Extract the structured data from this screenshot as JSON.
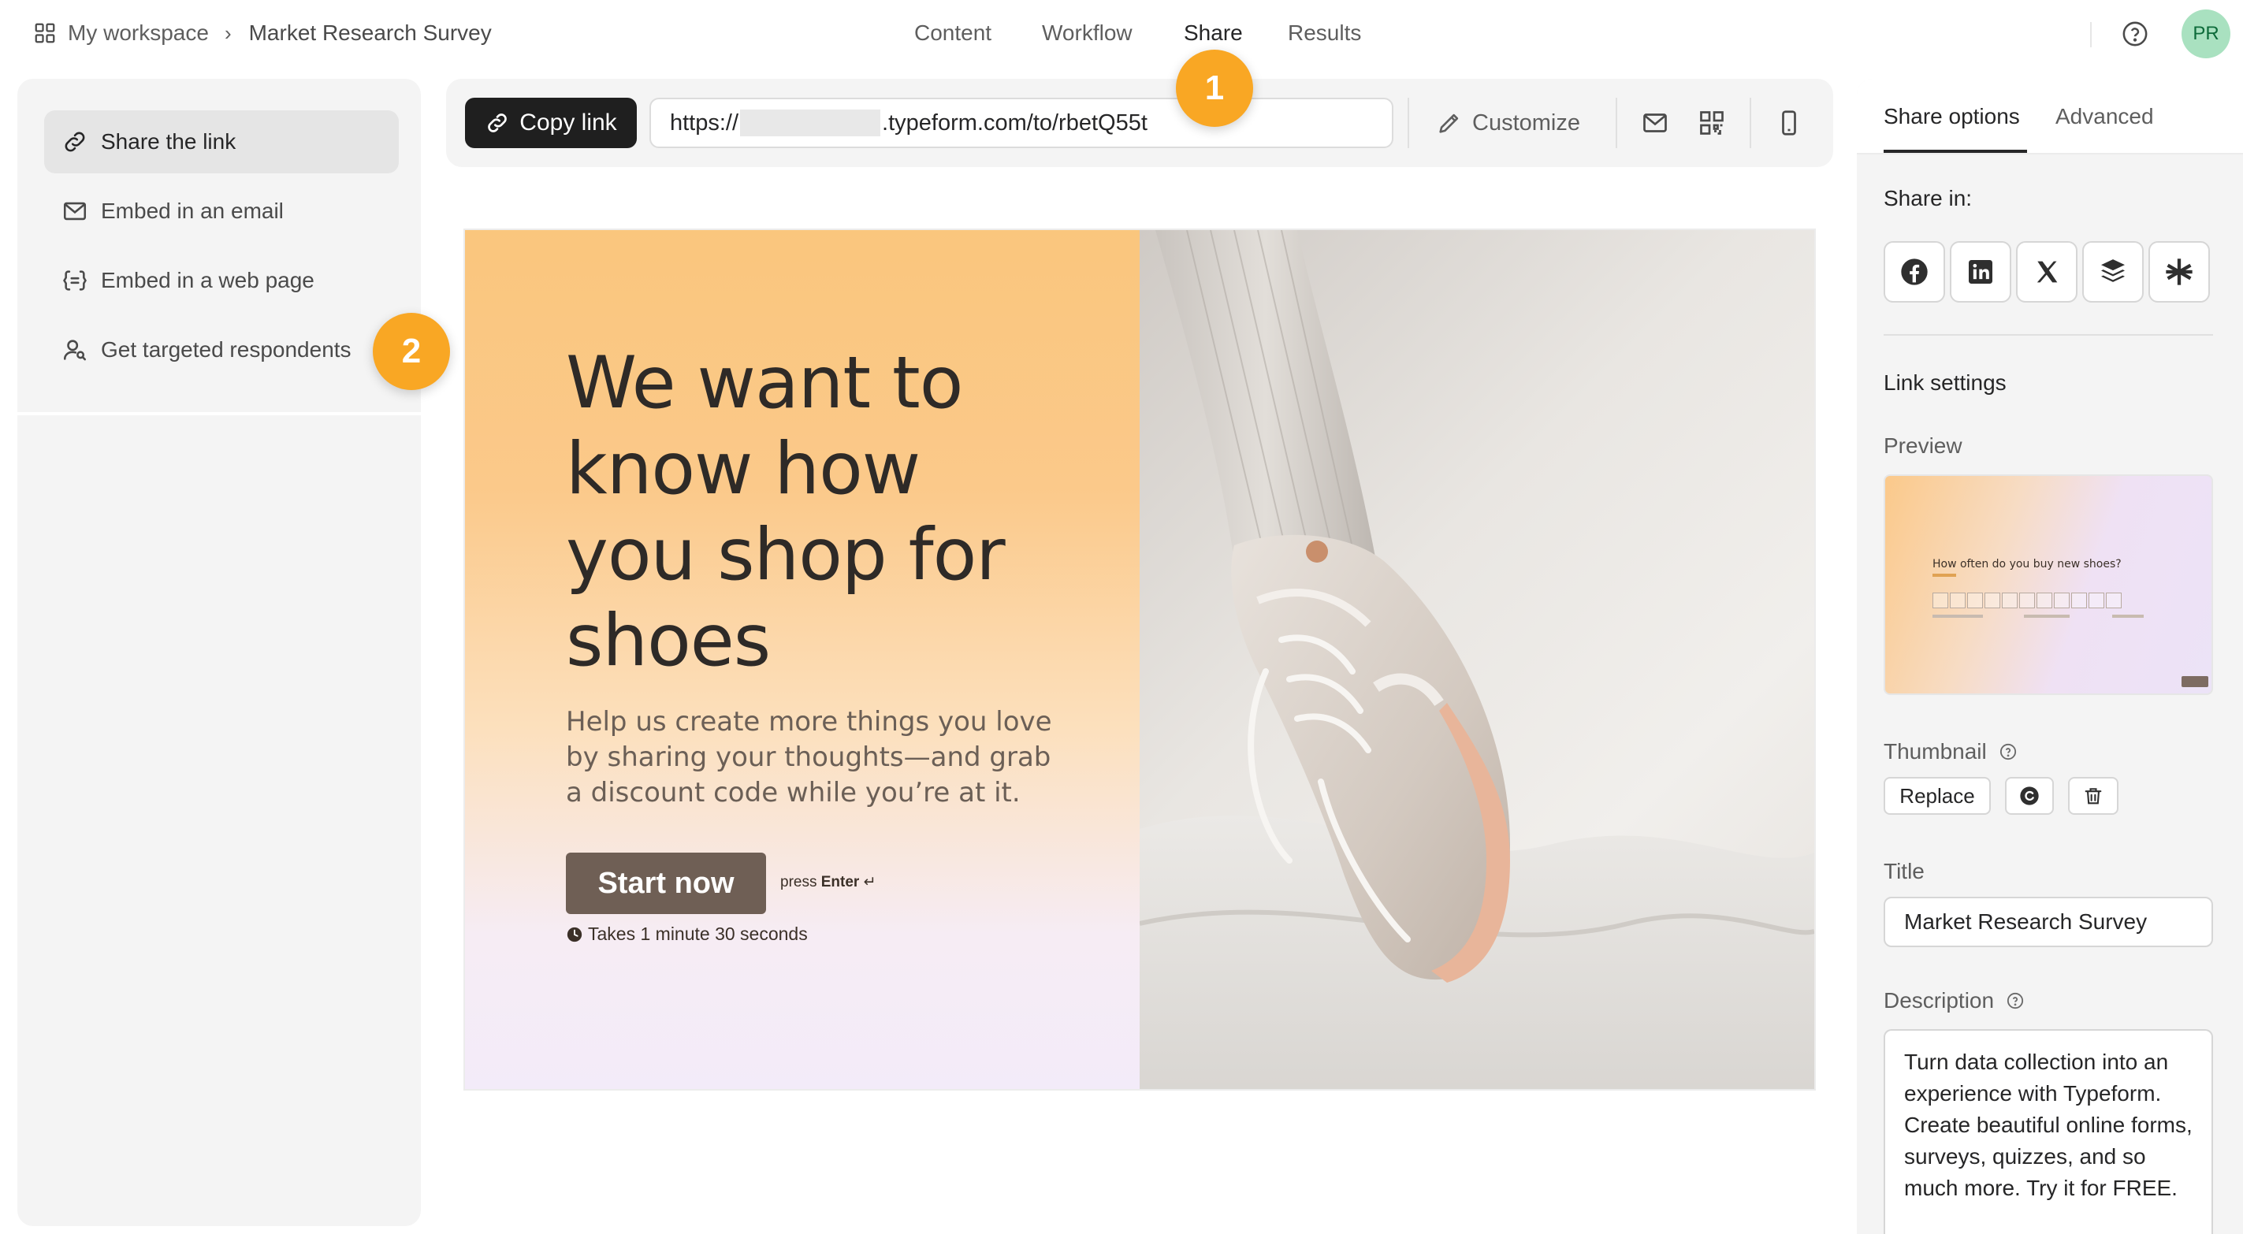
{
  "breadcrumb": {
    "workspace": "My workspace",
    "separator": "›",
    "form": "Market Research Survey"
  },
  "nav": {
    "tabs": [
      "Content",
      "Workflow",
      "Share",
      "Results"
    ],
    "active": "Share"
  },
  "user": {
    "initials": "PR",
    "avatar_color": "#a9e1c0"
  },
  "sidebar": {
    "items": [
      {
        "label": "Share the link",
        "icon": "link-icon",
        "active": true
      },
      {
        "label": "Embed in an email",
        "icon": "envelope-icon",
        "active": false
      },
      {
        "label": "Embed in a web page",
        "icon": "code-braces-icon",
        "active": false
      },
      {
        "label": "Get targeted respondents",
        "icon": "person-search-icon",
        "active": false
      }
    ]
  },
  "toolbar": {
    "copy_label": "Copy link",
    "url_prefix": "https://",
    "url_suffix": ".typeform.com/to/rbetQ55t",
    "customize_label": "Customize"
  },
  "preview": {
    "headline": "We want to know how you shop for shoes",
    "subcopy": "Help us create more things you love by sharing your thoughts—and grab a discount code while you’re at it.",
    "start_label": "Start now",
    "enter_hint_prefix": "press",
    "enter_hint_key": "Enter",
    "enter_hint_symbol": "↵",
    "duration": "Takes 1 minute 30 seconds"
  },
  "right_panel": {
    "tabs": [
      "Share options",
      "Advanced"
    ],
    "active_tab": "Share options",
    "share_in_label": "Share in:",
    "social": [
      "facebook-icon",
      "linkedin-icon",
      "x-icon",
      "buffer-icon",
      "linktree-icon"
    ],
    "link_settings_label": "Link settings",
    "preview_label": "Preview",
    "thumb_question": "How often do you buy new shoes?",
    "thumbnail_label": "Thumbnail",
    "replace_label": "Replace",
    "title_label": "Title",
    "title_value": "Market Research Survey",
    "description_label": "Description",
    "description_value": "Turn data collection into an experience with Typeform. Create beautiful online forms, surveys, quizzes, and so much more. Try it for FREE."
  },
  "markers": [
    "1",
    "2"
  ],
  "colors": {
    "accent_marker": "#f9a724",
    "primary_button": "#1f1f1f",
    "start_button": "#6f5f55"
  }
}
